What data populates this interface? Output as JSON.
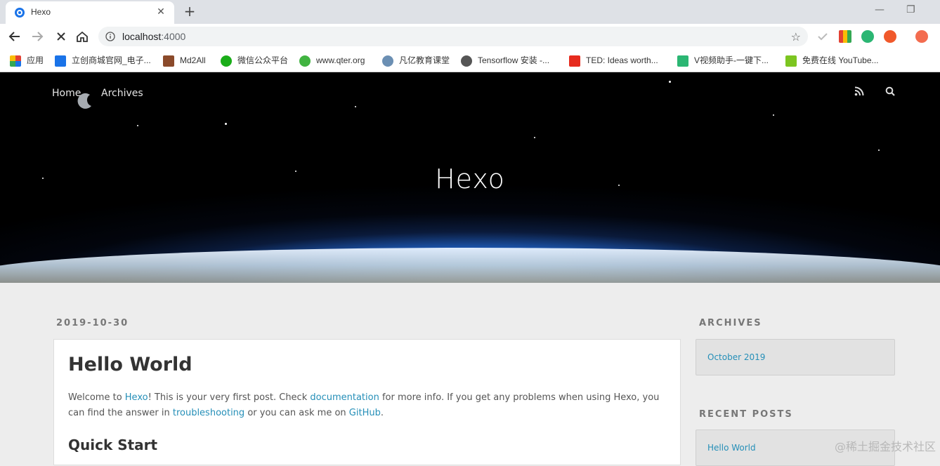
{
  "browser": {
    "tab_title": "Hexo",
    "url_host": "localhost",
    "url_port": ":4000",
    "bookmarks": [
      {
        "label": "应用",
        "icon": "apps-grid-icon",
        "color": "#e34133"
      },
      {
        "label": "立创商城官网_电子...",
        "icon": "lc-icon",
        "color": "#1a73e8"
      },
      {
        "label": "Md2All",
        "icon": "md2all-icon",
        "color": "#8b4a2b"
      },
      {
        "label": "微信公众平台",
        "icon": "wechat-icon",
        "color": "#1aad19"
      },
      {
        "label": "www.qter.org",
        "icon": "qter-icon",
        "color": "#41b341"
      },
      {
        "label": "凡亿教育课堂",
        "icon": "user-icon",
        "color": "#6b8fb3"
      },
      {
        "label": "Tensorflow 安装 -...",
        "icon": "globe-icon",
        "color": "#555555"
      },
      {
        "label": "TED: Ideas worth...",
        "icon": "ted-icon",
        "color": "#e62b1e"
      },
      {
        "label": "V视频助手-一键下...",
        "icon": "video-icon",
        "color": "#2bb673"
      },
      {
        "label": "免费在线 YouTube...",
        "icon": "download-icon",
        "color": "#7cc520"
      }
    ]
  },
  "hero": {
    "nav": [
      "Home",
      "Archives"
    ],
    "title": "Hexo"
  },
  "post": {
    "date": "2019-10-30",
    "title": "Hello World",
    "body": {
      "p1": "Welcome to ",
      "link_hexo": "Hexo",
      "p2": "! This is your very first post. Check ",
      "link_docs": "documentation",
      "p3": " for more info. If you get any problems when using Hexo, you can find the answer in ",
      "link_trouble": "troubleshooting",
      "p4": " or you can ask me on ",
      "link_github": "GitHub",
      "p5": "."
    },
    "h2": "Quick Start"
  },
  "sidebar": {
    "archives_heading": "ARCHIVES",
    "archives_link": "October 2019",
    "recent_heading": "RECENT POSTS",
    "recent_link": "Hello World"
  },
  "watermark": "@稀土掘金技术社区"
}
